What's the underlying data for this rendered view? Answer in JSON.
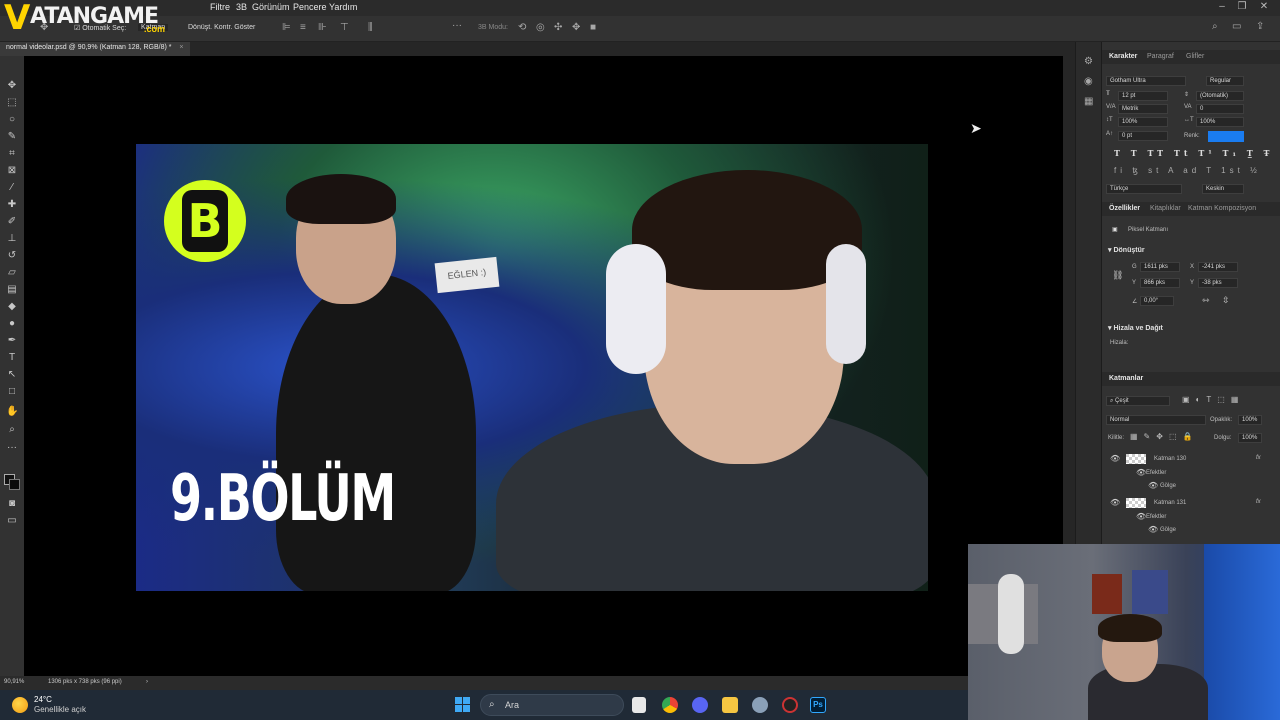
{
  "menubar": {
    "logo_main": "ATANGAME",
    "logo_v": "V",
    "logo_com": ".com",
    "items": [
      "Filtre",
      "3B",
      "Görünüm",
      "Pencere",
      "Yardım"
    ]
  },
  "optionsbar": {
    "auto_select": "Otomatik Seç:",
    "layer_select": "Katman",
    "transform_controls": "Dönüşt. Kontr. Göster",
    "mode_3d": "3B Modu:"
  },
  "document": {
    "tab_title": "normal videolar.psd @ 90,9% (Katman 128, RGB/8) *",
    "zoom": "90,91%",
    "dimensions": "1306 pks x 738 pks (96 ppi)"
  },
  "thumbnail": {
    "episode_text": "9.BÖLÜM",
    "badge_letter": "B",
    "note_text": "EĞLEN :)",
    "accent": "#d4ff1e"
  },
  "character_panel": {
    "tabs": [
      "Karakter",
      "Paragraf",
      "Glifler"
    ],
    "font_family": "Gotham Ultra",
    "font_style": "Regular",
    "size": "12 pt",
    "leading": "(Otomatik)",
    "kerning": "Metrik",
    "tracking": "0",
    "vertical_scale": "100%",
    "horizontal_scale": "100%",
    "baseline": "0 pt",
    "color_label": "Renk:",
    "color": "#1a7cf0",
    "language": "Türkçe",
    "antialias": "Keskin"
  },
  "properties_panel": {
    "tabs": [
      "Özellikler",
      "Kitaplıklar",
      "Katman Kompozisyon"
    ],
    "layer_type": "Piksel Katmanı",
    "transform_title": "Dönüştür",
    "w_label": "G",
    "w": "1611 pks",
    "x_label": "X",
    "x": "-241 pks",
    "h_label": "Y",
    "h": "866 pks",
    "y_label": "Y",
    "y": "-38 pks",
    "angle": "0,00°",
    "align_title": "Hizala ve Dağıt",
    "align_label": "Hizala:"
  },
  "layers_panel": {
    "title": "Katmanlar",
    "filter": "Çeşit",
    "blend_mode": "Normal",
    "opacity_label": "Opaklık:",
    "opacity": "100%",
    "lock_label": "Kilitle:",
    "fill_label": "Dolgu:",
    "fill": "100%",
    "layers": [
      {
        "name": "Katman 130",
        "effects": "Efektler",
        "effect": "Gölge"
      },
      {
        "name": "Katman 131",
        "effects": "Efektler",
        "effect": "Gölge"
      }
    ]
  },
  "taskbar": {
    "temperature": "24°C",
    "weather": "Genellikle açık",
    "search_placeholder": "Ara"
  }
}
